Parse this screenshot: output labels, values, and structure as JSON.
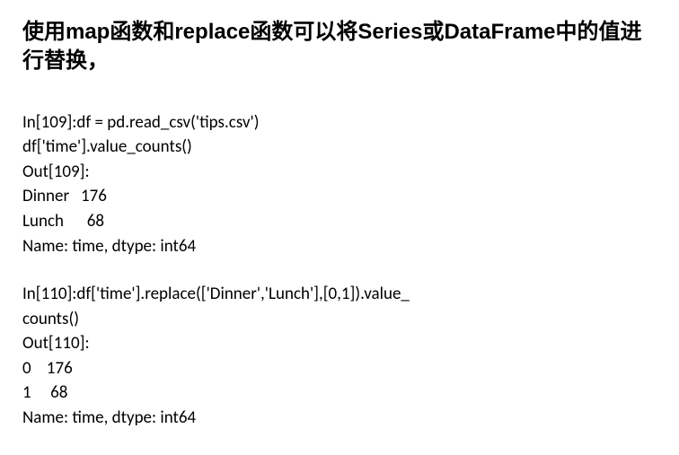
{
  "heading": "使用map函数和replace函数可以将Series或DataFrame中的值进行替换，",
  "code1": {
    "l1": "In[109]:df = pd.read_csv('tips.csv')",
    "l2": "df['time'].value_counts()",
    "l3": "Out[109]:",
    "l4": "Dinner   176",
    "l5": "Lunch      68",
    "l6": "Name: time, dtype: int64"
  },
  "code2": {
    "l1": "In[110]:df['time'].replace(['Dinner','Lunch'],[0,1]).value_",
    "l2": "counts()",
    "l3": "Out[110]:",
    "l4": "0    176",
    "l5": "1     68",
    "l6": "Name: time, dtype: int64"
  }
}
